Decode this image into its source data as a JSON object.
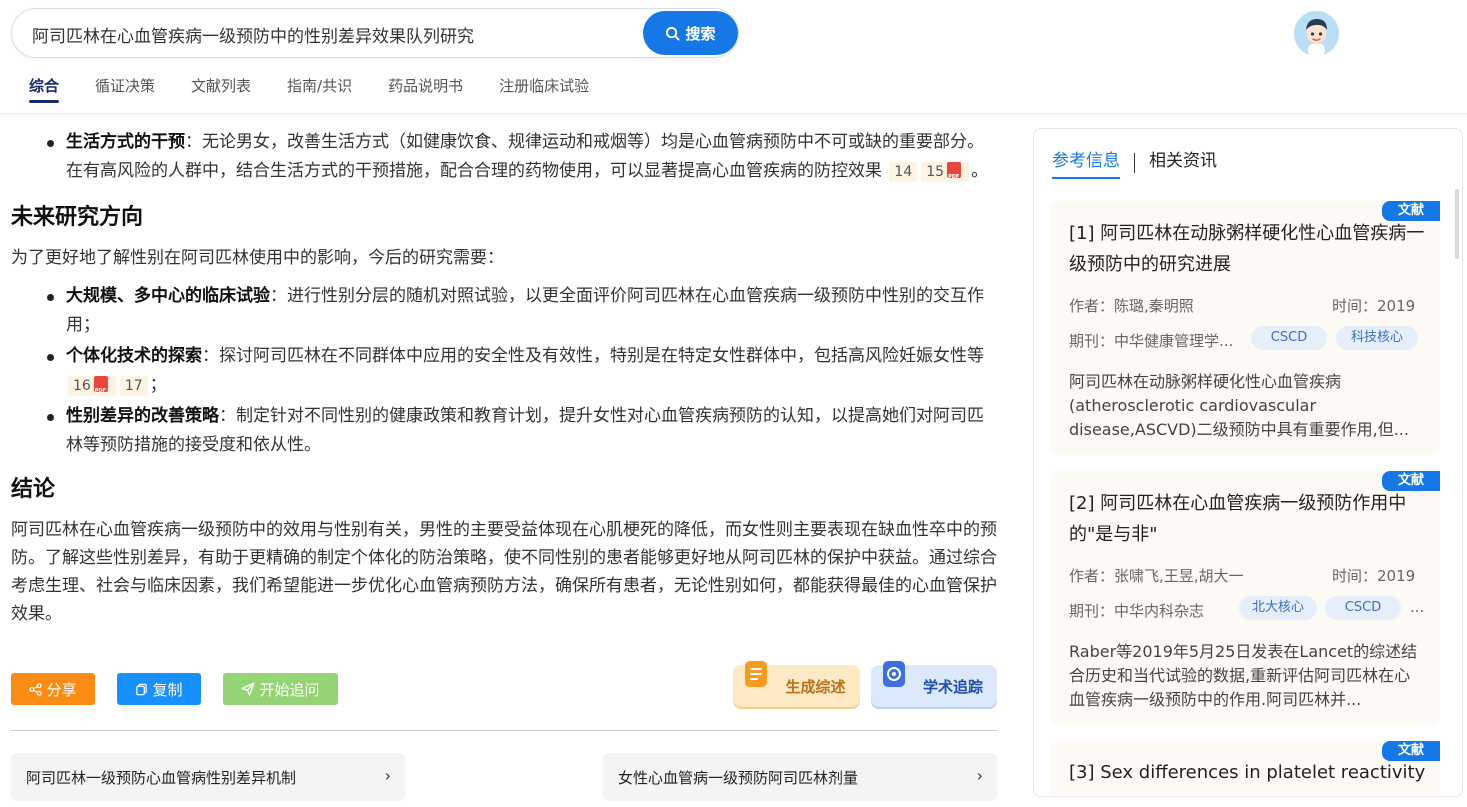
{
  "search": {
    "query": "阿司匹林在心血管疾病一级预防中的性别差异效果队列研究",
    "button_label": "搜索"
  },
  "tabs": [
    "综合",
    "循证决策",
    "文献列表",
    "指南/共识",
    "药品说明书",
    "注册临床试验"
  ],
  "content": {
    "bullet_lifestyle": {
      "bold": "生活方式的干预",
      "text": "：无论男女，改善生活方式（如健康饮食、规律运动和戒烟等）均是心血管病预防中不可或缺的重要部分。在有高风险的人群中，结合生活方式的干预措施，配合合理的药物使用，可以显著提高心血管疾病的防控效果",
      "cites": [
        "14",
        "15"
      ],
      "end": "。"
    },
    "future_heading": "未来研究方向",
    "future_intro": "为了更好地了解性别在阿司匹林使用中的影响，今后的研究需要：",
    "future_bullets": [
      {
        "bold": "大规模、多中心的临床试验",
        "text": "：进行性别分层的随机对照试验，以更全面评价阿司匹林在心血管疾病一级预防中性别的交互作用；"
      },
      {
        "bold": "个体化技术的探索",
        "text": "：探讨阿司匹林在不同群体中应用的安全性及有效性，特别是在特定女性群体中，包括高风险妊娠女性等",
        "cites": [
          "16",
          "17"
        ],
        "end": "；"
      },
      {
        "bold": "性别差异的改善策略",
        "text": "：制定针对不同性别的健康政策和教育计划，提升女性对心血管疾病预防的认知，以提高她们对阿司匹林等预防措施的接受度和依从性。"
      }
    ],
    "conclusion_heading": "结论",
    "conclusion_text": "阿司匹林在心血管疾病一级预防中的效用与性别有关，男性的主要受益体现在心肌梗死的降低，而女性则主要表现在缺血性卒中的预防。了解这些性别差异，有助于更精确的制定个体化的防治策略，使不同性别的患者能够更好地从阿司匹林的保护中获益。通过综合考虑生理、社会与临床因素，我们希望能进一步优化心血管病预防方法，确保所有患者，无论性别如何，都能获得最佳的心血管保护效果。"
  },
  "actions": {
    "share": "分享",
    "copy": "复制",
    "follow_up": "开始追问",
    "generate_review": "生成综述",
    "academic_tracking": "学术追踪"
  },
  "related_questions": [
    "阿司匹林一级预防心血管病性别差异机制",
    "女性心血管病一级预防阿司匹林剂量"
  ],
  "sidebar": {
    "tabs": [
      "参考信息",
      "相关资讯"
    ],
    "cards": [
      {
        "badge": "文献",
        "title": "[1] 阿司匹林在动脉粥样硬化性心血管疾病一级预防中的研究进展",
        "authors": "作者：陈璐,秦明照",
        "time": "时间：2019",
        "journal": "期刊：中华健康管理学...",
        "tags": [
          "CSCD",
          "科技核心"
        ],
        "abstract": "阿司匹林在动脉粥样硬化性心血管疾病(atherosclerotic cardiovascular disease,ASCVD)二级预防中具有重要作用,但..."
      },
      {
        "badge": "文献",
        "title": "[2] 阿司匹林在心血管疾病一级预防作用中的\"是与非\"",
        "authors": "作者：张啸飞,王昱,胡大一",
        "time": "时间：2019",
        "journal": "期刊：中华内科杂志",
        "tags": [
          "北大核心",
          "CSCD"
        ],
        "more": "...",
        "abstract": "Raber等2019年5月25日发表在Lancet的综述结合历史和当代试验的数据,重新评估阿司匹林在心血管疾病一级预防中的作用.阿司匹林并..."
      },
      {
        "badge": "文献",
        "title": "[3] Sex differences in platelet reactivity"
      }
    ]
  },
  "colors": {
    "primary": "#1677e6",
    "share": "#fa8c16",
    "copy": "#1890ff",
    "follow_up": "#95d475"
  }
}
